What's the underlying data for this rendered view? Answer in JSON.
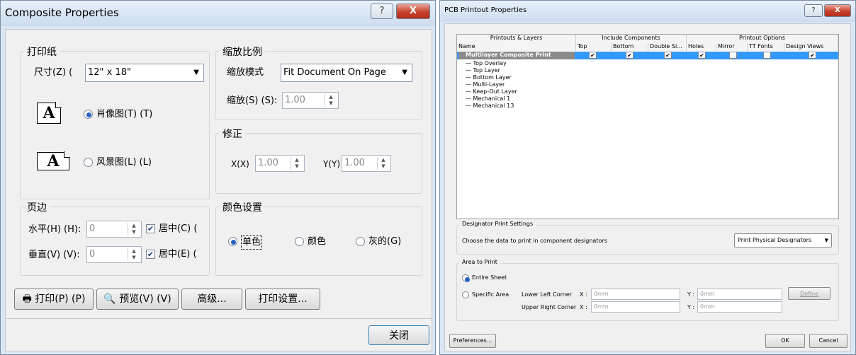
{
  "left_dialog": {
    "title": "Composite Properties",
    "help_label": "?",
    "close_x_label": "X",
    "paper": {
      "group_label": "打印纸",
      "size_label": "尺寸(Z) (",
      "size_value": "12\" x 18\"",
      "portrait_label": "肖像图(T) (T)",
      "landscape_label": "风景图(L) (L)",
      "icon_letter": "A"
    },
    "scale": {
      "group_label": "缩放比例",
      "mode_label": "缩放模式",
      "mode_value": "Fit Document On Page",
      "scale_label": "缩放(S) (S):",
      "scale_value": "1.00"
    },
    "correction": {
      "group_label": "修正",
      "x_label": "X(X)",
      "x_value": "1.00",
      "y_label": "Y(Y)",
      "y_value": "1.00"
    },
    "margins": {
      "group_label": "页边",
      "horizontal_label": "水平(H) (H):",
      "horizontal_value": "0",
      "vertical_label": "垂直(V) (V):",
      "vertical_value": "0",
      "center_h_label": "居中(C) (",
      "center_v_label": "居中(E) ("
    },
    "color": {
      "group_label": "颜色设置",
      "mono_label": "单色",
      "color_label": "颜色",
      "gray_label": "灰的(G)"
    },
    "buttons": {
      "print": "打印(P) (P)",
      "preview": "预览(V) (V)",
      "advanced": "高级...",
      "print_setup": "打印设置...",
      "close": "关闭"
    }
  },
  "right_dialog": {
    "title": "PCB Printout Properties",
    "table": {
      "group_headers": [
        "Printouts & Layers",
        "Include Components",
        "Printout Options"
      ],
      "columns": [
        "Name",
        "Top",
        "Bottom",
        "Double Si...",
        "Holes",
        "Mirror",
        "TT Fonts",
        "Design Views"
      ],
      "selected_row": "Multilayer Composite Print",
      "layers": [
        "Top Overlay",
        "Top Layer",
        "Bottom Layer",
        "Multi-Layer",
        "Keep-Out Layer",
        "Mechanical 1",
        "Mechanical 13"
      ]
    },
    "designator": {
      "group_label": "Designator Print Settings",
      "description": "Choose the data to print in component designators",
      "dropdown_value": "Print Physical Designators"
    },
    "area": {
      "group_label": "Area to Print",
      "entire_sheet": "Entire Sheet",
      "specific_area": "Specific Area",
      "lower_left": "Lower Left Corner",
      "upper_right": "Upper Right Corner",
      "x_label": "X :",
      "y_label": "Y :",
      "placeholder": "0mm",
      "define": "Define"
    },
    "buttons": {
      "preferences": "Preferences...",
      "ok": "OK",
      "cancel": "Cancel"
    }
  }
}
